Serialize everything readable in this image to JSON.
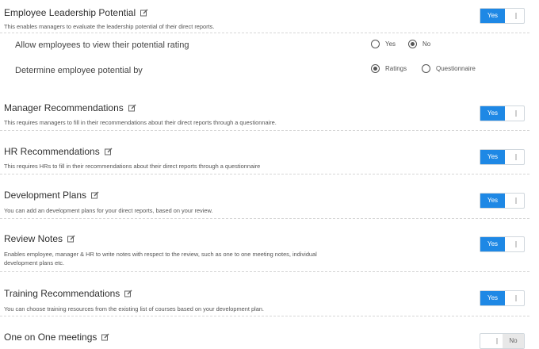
{
  "sections": {
    "leadership": {
      "title": "Employee Leadership Potential",
      "description": "This enables managers to evaluate the leadership potential of their direct reports.",
      "toggle": "Yes",
      "allow_label": "Allow employees to view their potential rating",
      "allow_yes": "Yes",
      "allow_no": "No",
      "determine_label": "Determine employee potential by",
      "determine_ratings": "Ratings",
      "determine_questionnaire": "Questionnaire"
    },
    "manager": {
      "title": "Manager Recommendations",
      "description": "This requires managers to fill in their recommendations about their direct reports through a questionnaire.",
      "toggle": "Yes"
    },
    "hr": {
      "title": "HR Recommendations",
      "description": "This requires HRs to fill in their recommendations about their direct reports through a questionnaire",
      "toggle": "Yes"
    },
    "development": {
      "title": "Development Plans",
      "description": "You can add an development plans for your direct reports, based on your review.",
      "toggle": "Yes"
    },
    "review_notes": {
      "title": "Review Notes",
      "description_line1": "Enables employee, manager & HR to write notes with respect to the review, such as one to one meeting notes, individual",
      "description_line2": "development plans etc.",
      "toggle": "Yes"
    },
    "training": {
      "title": "Training Recommendations",
      "description": "You can choose training resources from the existing list of courses based on your development plan.",
      "toggle": "Yes"
    },
    "one_on_one": {
      "title": "One on One meetings",
      "toggle": "No"
    }
  }
}
